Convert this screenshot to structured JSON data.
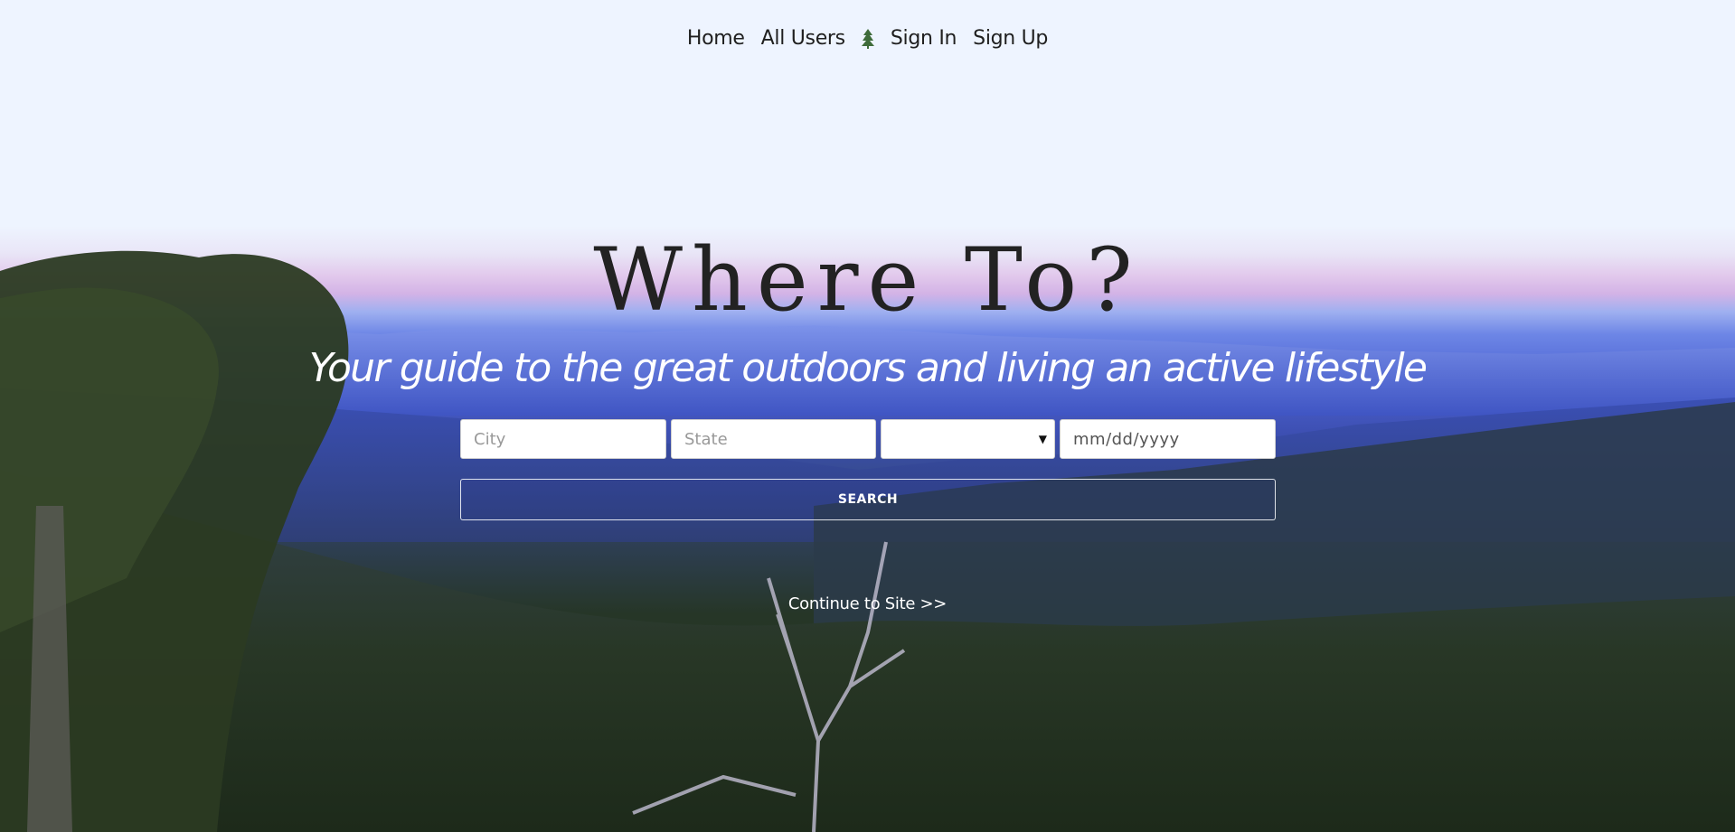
{
  "nav": {
    "items": [
      {
        "label": "Home"
      },
      {
        "label": "All Users"
      },
      {
        "label": "Sign In"
      },
      {
        "label": "Sign Up"
      }
    ],
    "tree_icon": "tree-icon"
  },
  "hero": {
    "title": "Where To?",
    "subtitle": "Your guide to the great outdoors and living an active lifestyle"
  },
  "search": {
    "city_placeholder": "City",
    "state_placeholder": "State",
    "activity_value": "",
    "date_placeholder": "mm/dd/yyyy",
    "button_label": "SEARCH"
  },
  "continue_link": "Continue to Site >>",
  "colors": {
    "tree_icon": "#3e6b3a",
    "text_dark": "#1f1f1f",
    "text_light": "#ffffff"
  }
}
